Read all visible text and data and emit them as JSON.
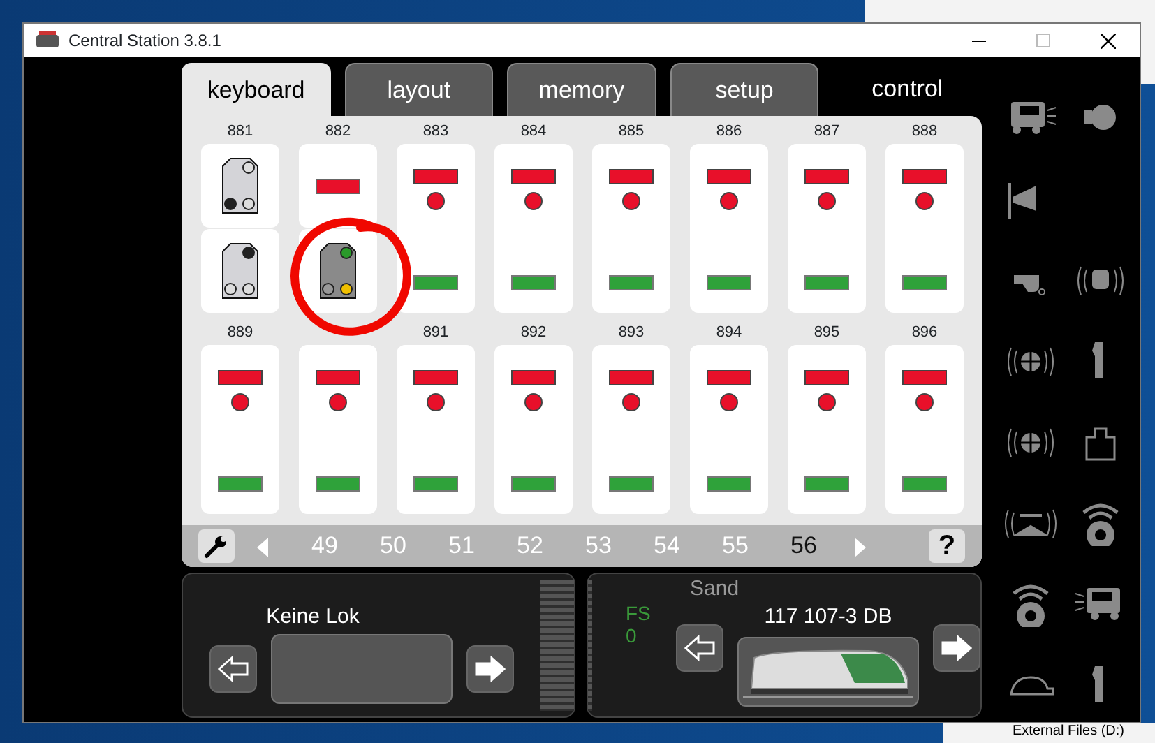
{
  "window": {
    "title": "Central Station 3.8.1"
  },
  "tabs": [
    {
      "label": "keyboard",
      "selected": true,
      "kind": "tab"
    },
    {
      "label": "layout",
      "selected": false,
      "kind": "tab"
    },
    {
      "label": "memory",
      "selected": false,
      "kind": "tab"
    },
    {
      "label": "setup",
      "selected": false,
      "kind": "tab"
    },
    {
      "label": "control",
      "selected": false,
      "kind": "plain"
    }
  ],
  "keyboard": {
    "items": [
      {
        "label": "881",
        "kind": "split",
        "halves": [
          {
            "kind": "plate-a"
          },
          {
            "kind": "plate-b"
          }
        ]
      },
      {
        "label": "882",
        "kind": "split",
        "halves": [
          {
            "kind": "red-bar"
          },
          {
            "kind": "signal-green-yellow"
          }
        ]
      },
      {
        "label": "883",
        "kind": "red-green"
      },
      {
        "label": "884",
        "kind": "red-green"
      },
      {
        "label": "885",
        "kind": "red-green"
      },
      {
        "label": "886",
        "kind": "red-green"
      },
      {
        "label": "887",
        "kind": "red-green"
      },
      {
        "label": "888",
        "kind": "red-green"
      },
      {
        "label": "889",
        "kind": "red-green"
      },
      {
        "kind": "red-green"
      },
      {
        "label": "891",
        "kind": "red-green"
      },
      {
        "label": "892",
        "kind": "red-green"
      },
      {
        "label": "893",
        "kind": "red-green"
      },
      {
        "label": "894",
        "kind": "red-green"
      },
      {
        "label": "895",
        "kind": "red-green"
      },
      {
        "label": "896",
        "kind": "red-green"
      }
    ],
    "pages": [
      {
        "label": "49",
        "selected": false
      },
      {
        "label": "50",
        "selected": false
      },
      {
        "label": "51",
        "selected": false
      },
      {
        "label": "52",
        "selected": false
      },
      {
        "label": "53",
        "selected": false
      },
      {
        "label": "54",
        "selected": false
      },
      {
        "label": "55",
        "selected": false
      },
      {
        "label": "56",
        "selected": true
      }
    ],
    "help": "?"
  },
  "locos": [
    {
      "kind": "empty",
      "name": "Keine Lok"
    },
    {
      "kind": "loaded",
      "name": "117 107-3 DB",
      "function": "Sand",
      "step_label": "FS",
      "step": "0"
    }
  ],
  "desktop": {
    "drive_label": "External Files (D:)"
  }
}
